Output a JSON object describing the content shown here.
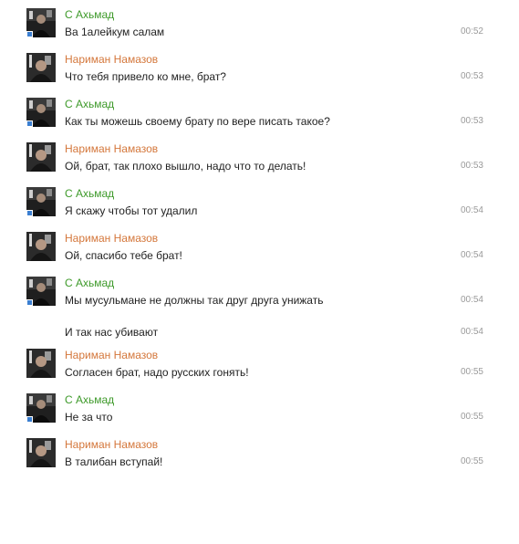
{
  "messages": [
    {
      "author": "С Ахьмад",
      "author_color": "green",
      "text": "Ва 1алейкум салам",
      "time": "00:52",
      "avatar": "avatar-ahmad",
      "online": true
    },
    {
      "author": "Нариман Намазов",
      "author_color": "orange",
      "text": "Что тебя привело ко мне, брат?",
      "time": "00:53",
      "avatar": "avatar-nariman",
      "online": false
    },
    {
      "author": "С Ахьмад",
      "author_color": "green",
      "text": "Как ты можешь своему брату по вере писать такое?",
      "time": "00:53",
      "avatar": "avatar-ahmad",
      "online": true
    },
    {
      "author": "Нариман Намазов",
      "author_color": "orange",
      "text": "Ой, брат, так плохо вышло, надо что то делать!",
      "time": "00:53",
      "avatar": "avatar-nariman",
      "online": false
    },
    {
      "author": "С Ахьмад",
      "author_color": "green",
      "text": "Я скажу чтобы тот удалил",
      "time": "00:54",
      "avatar": "avatar-ahmad",
      "online": true
    },
    {
      "author": "Нариман Намазов",
      "author_color": "orange",
      "text": "Ой, спасибо тебе брат!",
      "time": "00:54",
      "avatar": "avatar-nariman",
      "online": false
    },
    {
      "author": "С Ахьмад",
      "author_color": "green",
      "text": "Мы мусульмане не должны так друг друга унижать",
      "time": "00:54",
      "avatar": "avatar-ahmad",
      "online": true
    },
    {
      "author": "",
      "author_color": "",
      "text": "И так нас убивают",
      "time": "00:54",
      "avatar": "",
      "online": false,
      "continuation": true
    },
    {
      "author": "Нариман Намазов",
      "author_color": "orange",
      "text": "Согласен брат, надо русских гонять!",
      "time": "00:55",
      "avatar": "avatar-nariman",
      "online": false
    },
    {
      "author": "С Ахьмад",
      "author_color": "green",
      "text": "Не за что",
      "time": "00:55",
      "avatar": "avatar-ahmad",
      "online": true
    },
    {
      "author": "Нариман Намазов",
      "author_color": "orange",
      "text": "В талибан вступай!",
      "time": "00:55",
      "avatar": "avatar-nariman",
      "online": false
    }
  ],
  "colors": {
    "green": "#3e9a2a",
    "orange": "#d4773b",
    "online_indicator": "#3b7fd1",
    "timestamp": "#9a9a9a",
    "text": "#222222"
  }
}
